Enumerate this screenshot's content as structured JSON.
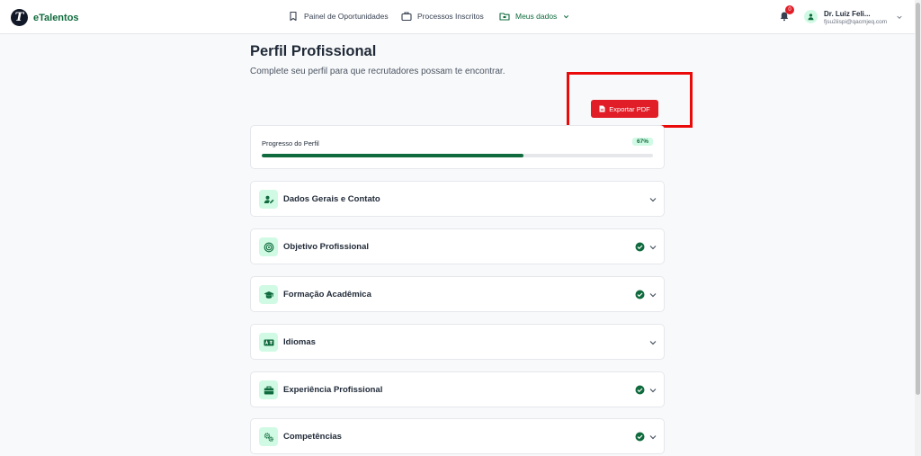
{
  "header": {
    "brand": "eTalentos",
    "brand_initial": "T",
    "nav": [
      {
        "label": "Painel de Oportunidades",
        "icon": "bookmark-icon"
      },
      {
        "label": "Processos Inscritos",
        "icon": "briefcase-icon"
      },
      {
        "label": "Meus dados",
        "icon": "folder-icon",
        "active": true
      }
    ],
    "notifications_count": "0",
    "user": {
      "name": "Dr. Luiz Feli...",
      "email": "fjsu2iispi@qacmjeq.com"
    }
  },
  "page": {
    "title": "Perfil Profissional",
    "subtitle": "Complete seu perfil para que recrutadores possam te encontrar.",
    "export_label": "Exportar PDF"
  },
  "progress": {
    "label": "Progresso do Perfil",
    "percent_label": "67%",
    "value": 67
  },
  "sections": [
    {
      "title": "Dados Gerais e Contato",
      "icon": "user-edit-icon",
      "complete": false
    },
    {
      "title": "Objetivo Profissional",
      "icon": "target-icon",
      "complete": true
    },
    {
      "title": "Formação Acadêmica",
      "icon": "graduation-cap-icon",
      "complete": true
    },
    {
      "title": "Idiomas",
      "icon": "language-icon",
      "complete": false
    },
    {
      "title": "Experiência Profissional",
      "icon": "briefcase-icon",
      "complete": true
    },
    {
      "title": "Competências",
      "icon": "gears-icon",
      "complete": true
    }
  ],
  "colors": {
    "brand": "#0f6b3d",
    "accent_red": "#e11d27",
    "icon_bg": "#d1fae5",
    "highlight": "#ea0a0a"
  }
}
